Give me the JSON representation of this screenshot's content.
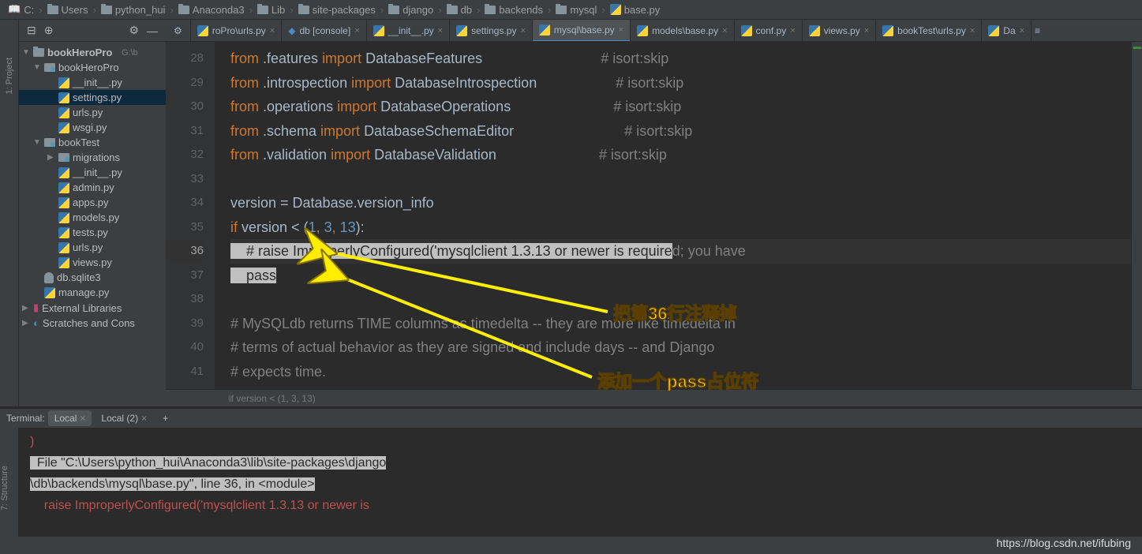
{
  "breadcrumb": [
    "C:",
    "Users",
    "python_hui",
    "Anaconda3",
    "Lib",
    "site-packages",
    "django",
    "db",
    "backends",
    "mysql",
    "base.py"
  ],
  "toolbar": {
    "proj_tab": "1: Project"
  },
  "tree": {
    "root": {
      "name": "bookHeroPro",
      "meta": "G:\\b"
    },
    "items": [
      {
        "ind": 1,
        "type": "folder",
        "name": "bookHeroPro",
        "arrow": "▼"
      },
      {
        "ind": 2,
        "type": "py",
        "name": "__init__.py"
      },
      {
        "ind": 2,
        "type": "py",
        "name": "settings.py",
        "sel": true
      },
      {
        "ind": 2,
        "type": "py",
        "name": "urls.py"
      },
      {
        "ind": 2,
        "type": "py",
        "name": "wsgi.py"
      },
      {
        "ind": 1,
        "type": "folder",
        "name": "bookTest",
        "arrow": "▼"
      },
      {
        "ind": 2,
        "type": "folder",
        "name": "migrations",
        "arrow": "▶"
      },
      {
        "ind": 2,
        "type": "py",
        "name": "__init__.py"
      },
      {
        "ind": 2,
        "type": "py",
        "name": "admin.py"
      },
      {
        "ind": 2,
        "type": "py",
        "name": "apps.py"
      },
      {
        "ind": 2,
        "type": "py",
        "name": "models.py"
      },
      {
        "ind": 2,
        "type": "py",
        "name": "tests.py"
      },
      {
        "ind": 2,
        "type": "py",
        "name": "urls.py"
      },
      {
        "ind": 2,
        "type": "py",
        "name": "views.py"
      },
      {
        "ind": 1,
        "type": "db",
        "name": "db.sqlite3"
      },
      {
        "ind": 1,
        "type": "py",
        "name": "manage.py"
      }
    ],
    "ext_lib": "External Libraries",
    "scratches": "Scratches and Cons"
  },
  "tabs": [
    {
      "label": "roPro\\urls.py",
      "icon": "py"
    },
    {
      "label": "db [console]",
      "icon": "db"
    },
    {
      "label": "__init__.py",
      "icon": "py"
    },
    {
      "label": "settings.py",
      "icon": "py"
    },
    {
      "label": "mysql\\base.py",
      "icon": "py",
      "active": true
    },
    {
      "label": "models\\base.py",
      "icon": "py"
    },
    {
      "label": "conf.py",
      "icon": "py"
    },
    {
      "label": "views.py",
      "icon": "py"
    },
    {
      "label": "bookTest\\urls.py",
      "icon": "py"
    },
    {
      "label": "Da",
      "icon": "py"
    }
  ],
  "lines": [
    "28",
    "29",
    "30",
    "31",
    "32",
    "33",
    "34",
    "35",
    "36",
    "37",
    "38",
    "39",
    "40",
    "41"
  ],
  "code": {
    "l28a": "from ",
    "l28b": ".features ",
    "l28c": "import ",
    "l28d": "DatabaseFeatures",
    "l28e": "# isort:skip",
    "l29a": "from ",
    "l29b": ".introspection ",
    "l29c": "import ",
    "l29d": "DatabaseIntrospection",
    "l29e": "# isort:skip",
    "l30a": "from ",
    "l30b": ".operations ",
    "l30c": "import ",
    "l30d": "DatabaseOperations",
    "l30e": "# isort:skip",
    "l31a": "from ",
    "l31b": ".schema ",
    "l31c": "import ",
    "l31d": "DatabaseSchemaEditor",
    "l31e": "# isort:skip",
    "l32a": "from ",
    "l32b": ".validation ",
    "l32c": "import ",
    "l32d": "DatabaseValidation",
    "l32e": "# isort:skip",
    "l34": "version = Database.version_info",
    "l35a": "if ",
    "l35b": "version < (",
    "l35c": "1",
    "l35d": ", ",
    "l35e": "3",
    "l35f": ", ",
    "l35g": "13",
    "l35h": "):",
    "l36": "    # raise ImproperlyConfigured('mysqlclient 1.3.13 or newer is required; you have",
    "l37": "    pass",
    "l39": "# MySQLdb returns TIME columns as timedelta -- they are more like timedelta in",
    "l40": "# terms of actual behavior as they are signed and include days -- and Django",
    "l41": "# expects time."
  },
  "crumb_status": "if version < (1, 3, 13)",
  "terminal": {
    "title": "Terminal:",
    "tab1": "Local",
    "tab2": "Local (2)",
    "l1": ")",
    "l2": "  File \"C:\\Users\\python_hui\\Anaconda3\\lib\\site-packages\\django",
    "l3": "\\db\\backends\\mysql\\base.py\", line 36, in <module>",
    "l4": "    raise ImproperlyConfigured('mysqlclient 1.3.13 or newer is"
  },
  "structure_tab": "7: Structure",
  "annotations": {
    "a1": "把第36行注释掉",
    "a2": "添加一个pass占位符"
  },
  "watermark": "https://blog.csdn.net/ifubing"
}
